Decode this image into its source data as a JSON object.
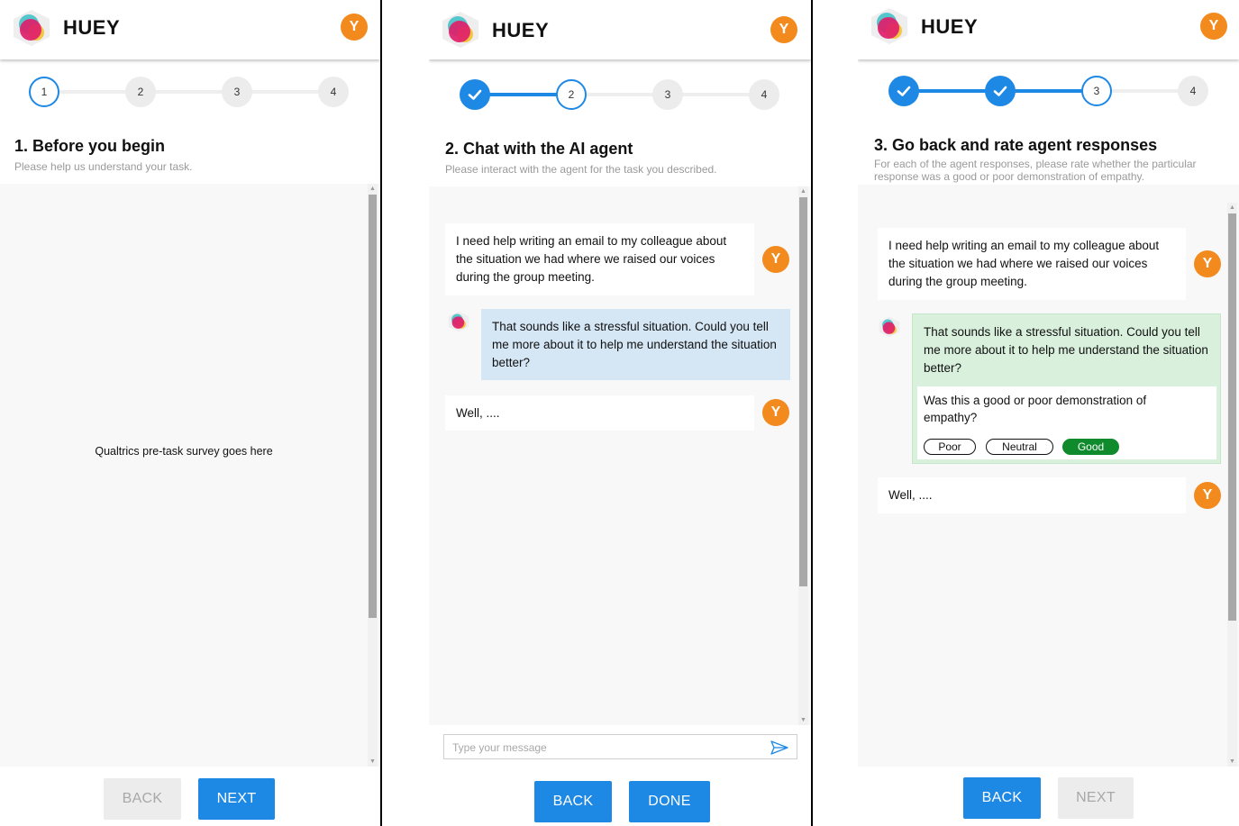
{
  "brand": {
    "name": "HUEY",
    "user_initial": "Y"
  },
  "colors": {
    "accent": "#1e88e5",
    "avatar": "#f28a1e",
    "good": "#0f8a2c",
    "agent_bubble": "#d5e6f5",
    "rated_bubble": "#d8f0dc"
  },
  "steps": [
    "1",
    "2",
    "3",
    "4"
  ],
  "icons": {
    "logo": "huey-logo-icon",
    "check": "check-icon",
    "send": "send-icon"
  },
  "panel1": {
    "title": "1. Before you begin",
    "subtitle": "Please help us understand your task.",
    "survey_placeholder": "Qualtrics pre-task survey goes here",
    "back_label": "BACK",
    "next_label": "NEXT"
  },
  "panel2": {
    "title": "2. Chat with the AI agent",
    "subtitle": "Please interact with the agent for the task you described.",
    "messages": [
      {
        "role": "user",
        "text": "I need help writing an email to my colleague about the situation we had where we raised our voices during the group meeting."
      },
      {
        "role": "agent",
        "text": "That sounds like a stressful situation. Could you tell me more about it to help me understand the situation better?"
      },
      {
        "role": "user",
        "text": "Well, ...."
      }
    ],
    "input_placeholder": "Type your message",
    "back_label": "BACK",
    "done_label": "DONE"
  },
  "panel3": {
    "title": "3. Go back and rate agent responses",
    "subtitle": "For each of the agent responses, please rate whether the particular response was a good or poor demonstration of empathy.",
    "messages": [
      {
        "role": "user",
        "text": "I need help writing an email to my colleague about the situation we had where we raised our voices during the group meeting."
      },
      {
        "role": "agent",
        "text": "That sounds like a stressful situation. Could you tell me more about it to help me understand the situation better?"
      },
      {
        "role": "user",
        "text": "Well, ...."
      }
    ],
    "rating_question": "Was this a good or poor demonstration of empathy?",
    "rating_options": [
      "Poor",
      "Neutral",
      "Good"
    ],
    "rating_selected": "Good",
    "back_label": "BACK",
    "next_label": "NEXT"
  }
}
